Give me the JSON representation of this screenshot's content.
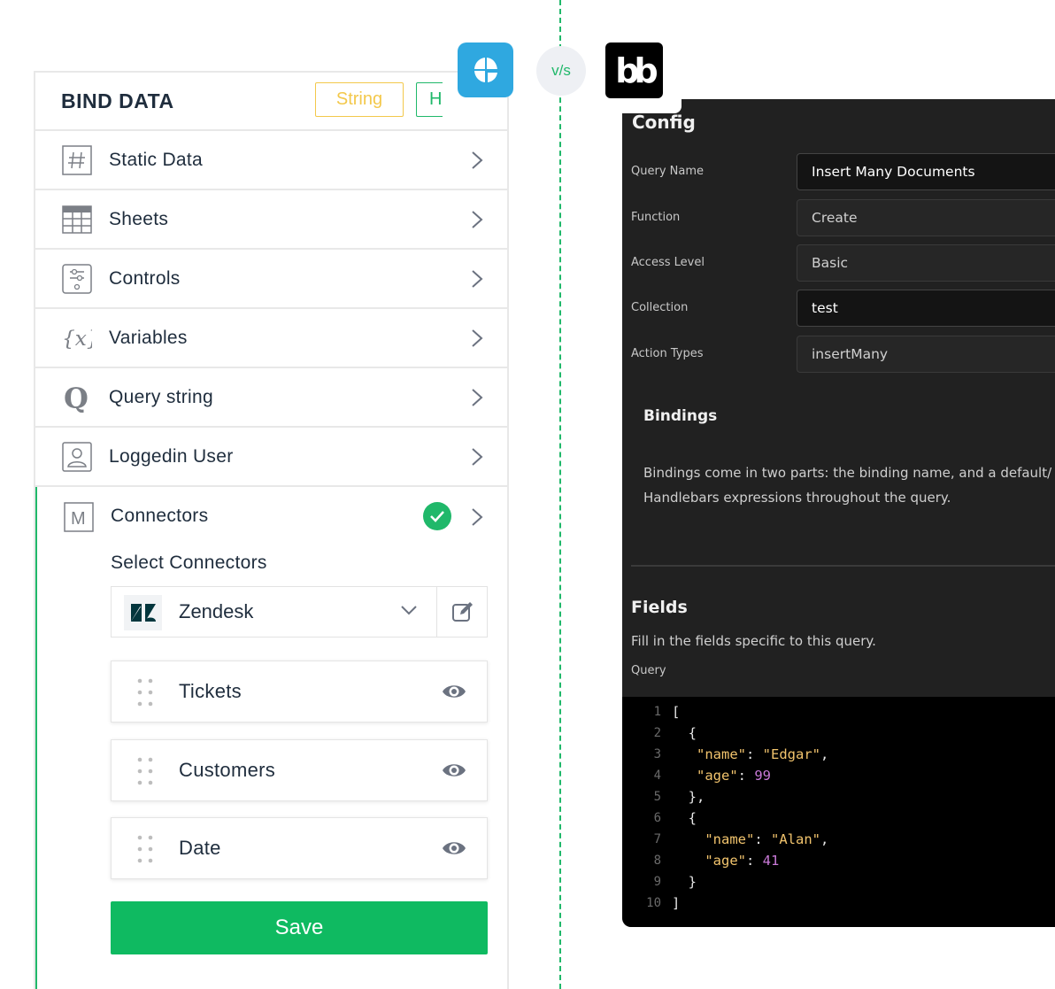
{
  "versus_label": "v/s",
  "right_logo_text": "bb",
  "bind_panel": {
    "title": "BIND DATA",
    "tags": [
      "String",
      "H"
    ],
    "items": [
      {
        "label": "Static Data",
        "icon": "hash-icon"
      },
      {
        "label": "Sheets",
        "icon": "table-icon"
      },
      {
        "label": "Controls",
        "icon": "sliders-icon"
      },
      {
        "label": "Variables",
        "icon": "variable-icon"
      },
      {
        "label": "Query string",
        "icon": "q-icon"
      },
      {
        "label": "Loggedin User",
        "icon": "user-icon"
      }
    ],
    "connectors": {
      "label": "Connectors",
      "icon": "m-icon",
      "status": "check-icon",
      "select_heading": "Select Connectors",
      "selected": "Zendesk",
      "fields": [
        "Tickets",
        "Customers",
        "Date"
      ],
      "save_label": "Save"
    }
  },
  "query_panel": {
    "config_title": "Config",
    "fields": [
      {
        "label": "Query Name",
        "value": "Insert Many Documents"
      },
      {
        "label": "Function",
        "value": "Create"
      },
      {
        "label": "Access Level",
        "value": "Basic"
      },
      {
        "label": "Collection",
        "value": "test"
      },
      {
        "label": "Action Types",
        "value": "insertMany"
      }
    ],
    "bindings_title": "Bindings",
    "bindings_text_1": "Bindings come in two parts: the binding name, and a default/",
    "bindings_text_2": "Handlebars expressions throughout the query.",
    "fields_title": "Fields",
    "fields_subtitle": "Fill in the fields specific to this query.",
    "query_label": "Query",
    "code_line_numbers": [
      "1",
      "2",
      "3",
      "4",
      "5",
      "6",
      "7",
      "8",
      "9",
      "10"
    ]
  },
  "colors": {
    "accent_green": "#0fba61",
    "string_tag": "#f3c84b",
    "left_logo_bg": "#2fa8e0",
    "dark_panel": "#212121"
  }
}
